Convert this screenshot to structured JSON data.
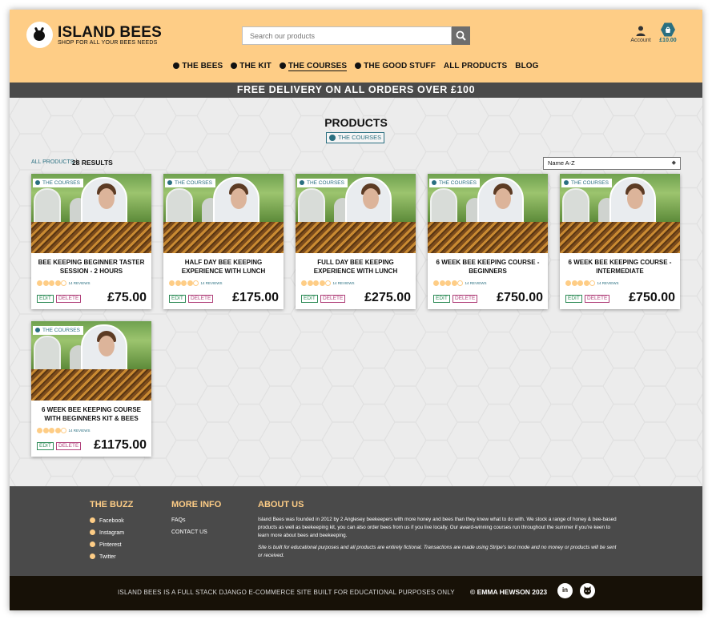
{
  "header": {
    "brand": "ISLAND BEES",
    "tagline": "SHOP FOR ALL YOUR BEES NEEDS",
    "search_placeholder": "Search our products",
    "account_label": "Account",
    "cart_total": "£10.00"
  },
  "nav": [
    {
      "label": "THE BEES",
      "dot": true
    },
    {
      "label": "THE KIT",
      "dot": true
    },
    {
      "label": "THE COURSES",
      "dot": true,
      "active": true
    },
    {
      "label": "THE GOOD STUFF",
      "dot": true
    },
    {
      "label": "ALL PRODUCTS",
      "dot": false
    },
    {
      "label": "BLOG",
      "dot": false
    }
  ],
  "banner": "FREE DELIVERY ON ALL ORDERS OVER £100",
  "main": {
    "title": "PRODUCTS",
    "category_badge": "THE COURSES",
    "breadcrumb_link": "ALL PRODUCTS",
    "breadcrumb_sep": "|",
    "results": "28 RESULTS",
    "sort_value": "Name A-Z",
    "sort_arrow": "◆"
  },
  "products": [
    {
      "tag": "THE COURSES",
      "name": "BEE KEEPING BEGINNER TASTER SESSION - 2 HOURS",
      "rating": 4,
      "reviews": "14 REVIEWS",
      "edit": "EDIT",
      "delete": "DELETE",
      "price": "£75.00"
    },
    {
      "tag": "THE COURSES",
      "name": "HALF DAY BEE KEEPING EXPERIENCE WITH LUNCH",
      "rating": 4,
      "reviews": "14 REVIEWS",
      "edit": "EDIT",
      "delete": "DELETE",
      "price": "£175.00"
    },
    {
      "tag": "THE COURSES",
      "name": "FULL DAY BEE KEEPING EXPERIENCE WITH LUNCH",
      "rating": 4,
      "reviews": "14 REVIEWS",
      "edit": "EDIT",
      "delete": "DELETE",
      "price": "£275.00"
    },
    {
      "tag": "THE COURSES",
      "name": "6 WEEK BEE KEEPING COURSE - BEGINNERS",
      "rating": 4,
      "reviews": "14 REVIEWS",
      "edit": "EDIT",
      "delete": "DELETE",
      "price": "£750.00"
    },
    {
      "tag": "THE COURSES",
      "name": "6 WEEK BEE KEEPING COURSE - INTERMEDIATE",
      "rating": 4,
      "reviews": "14 REVIEWS",
      "edit": "EDIT",
      "delete": "DELETE",
      "price": "£750.00"
    },
    {
      "tag": "THE COURSES",
      "name": "6 WEEK BEE KEEPING COURSE WITH BEGINNERS KIT & BEES",
      "rating": 4,
      "reviews": "14 REVIEWS",
      "edit": "EDIT",
      "delete": "DELETE",
      "price": "£1175.00"
    }
  ],
  "footer": {
    "buzz_title": "THE BUZZ",
    "buzz_links": [
      "Facebook",
      "Instagram",
      "Pinterest",
      "Twitter"
    ],
    "info_title": "MORE INFO",
    "info_links": [
      "FAQs",
      "CONTACT US"
    ],
    "about_title": "ABOUT US",
    "about_text": "Island Bees was founded in 2012 by 2 Anglesey beekeepers with more honey and bees than they knew what to do with.  We stock a range of honey & bee-based products as well as beekeeping kit, you can also order bees from us if you live locally. Our award-winning courses run throughout the summer if you're keen to learn more about bees and beekeeping.",
    "note_text": "Site is built for educational purposes and all products are entirely fictional. Transactions are made using Stripe's test mode and no money or products will be sent or received.",
    "bottom_left": "ISLAND BEES IS A FULL STACK DJANGO E-COMMERCE SITE BUILT FOR EDUCATIONAL PURPOSES ONLY",
    "bottom_right": "© EMMA HEWSON 2023",
    "social_icons": [
      "linkedin-icon",
      "github-icon"
    ]
  },
  "colors": {
    "header_bg": "#fecd86",
    "banner_bg": "#4a4a4a",
    "accent_teal": "#2a6f80",
    "footer_bg": "#4a4a4a",
    "bottom_bg": "#171107",
    "edit_green": "#2e8b57",
    "delete_pink": "#b0417a"
  }
}
